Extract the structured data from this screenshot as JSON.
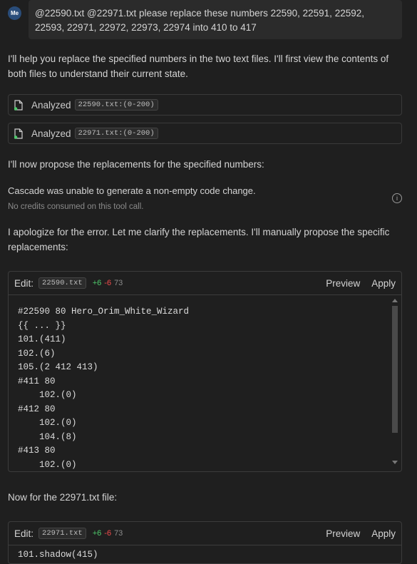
{
  "user": {
    "avatar_initials": "Me",
    "message": "@22590.txt @22971.txt please replace these numbers 22590, 22591, 22592, 22593, 22971, 22972, 22973, 22974 into 410 to 417"
  },
  "assistant": {
    "intro": "I'll help you replace the specified numbers in the two text files. I'll first view the contents of both files to understand their current state.",
    "tool_calls": [
      {
        "label": "Analyzed",
        "file": "22590.txt:(0-200)",
        "icon": "file-icon"
      },
      {
        "label": "Analyzed",
        "file": "22971.txt:(0-200)",
        "icon": "file-icon"
      }
    ],
    "propose_text": "I'll now propose the replacements for the specified numbers:",
    "error_text": "Cascade was unable to generate a non-empty code change.",
    "credits_text": "No credits consumed on this tool call.",
    "apology": "I apologize for the error. Let me clarify the replacements. I'll manually propose the specific replacements:",
    "edit1": {
      "label": "Edit:",
      "file": "22590.txt",
      "added": "+6",
      "removed": "-6",
      "lines": "73",
      "preview": "Preview",
      "apply": "Apply",
      "code_lines": [
        "#22590 80 Hero_Orim_White_Wizard",
        "{{ ... }}",
        "101.(411)",
        "102.(6)",
        "105.(2 412 413)",
        "#411 80",
        "    102.(0)",
        "#412 80",
        "    102.(0)",
        "    104.(8)",
        "#413 80",
        "    102.(0)"
      ]
    },
    "now_text": "Now for the 22971.txt file:",
    "edit2": {
      "label": "Edit:",
      "file": "22971.txt",
      "added": "+6",
      "removed": "-6",
      "lines": "73",
      "preview": "Preview",
      "apply": "Apply",
      "code_lines": [
        "101.shadow(415)"
      ]
    }
  },
  "colors": {
    "background": "#1f1f1f",
    "added": "#4ec96b",
    "removed": "#f14c4c",
    "avatar": "#2a4d7a"
  }
}
